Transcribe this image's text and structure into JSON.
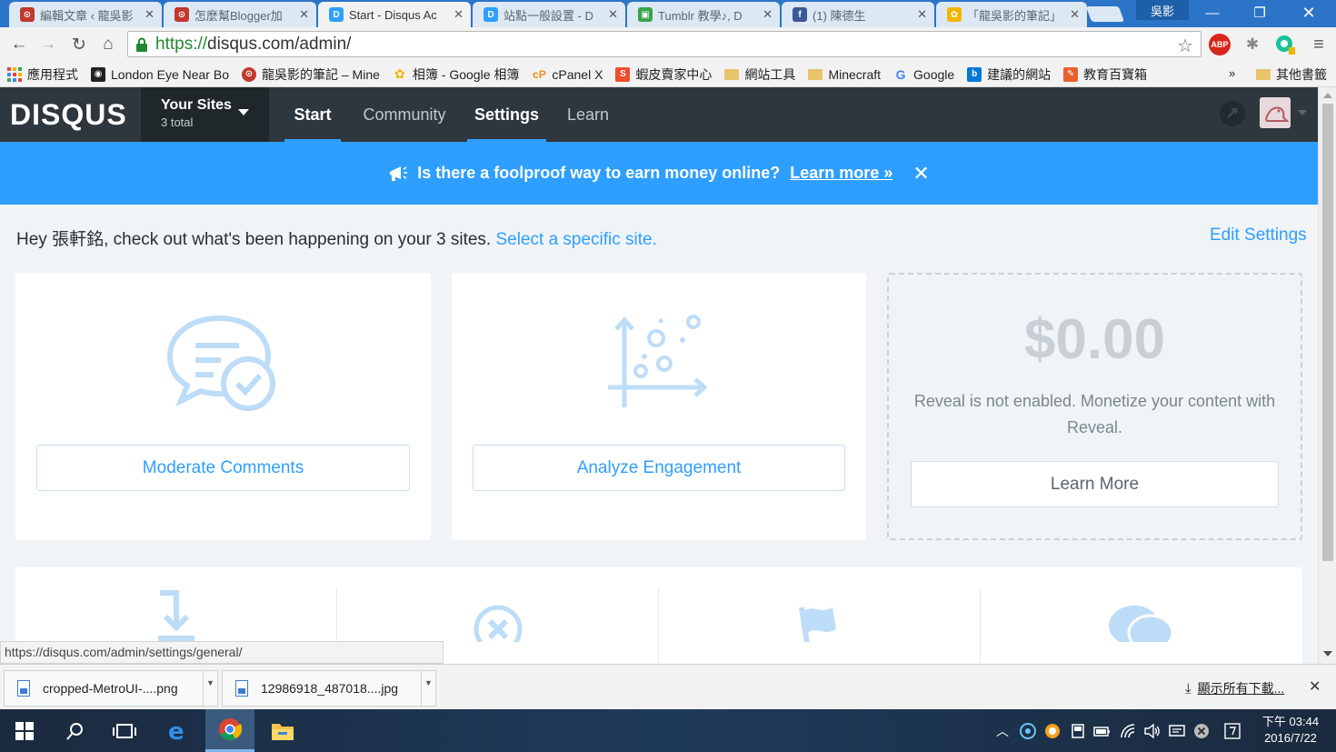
{
  "browser": {
    "tabs": [
      {
        "title": "編輯文章 ‹ 龍吳影",
        "fav_color": "#c0392b",
        "fav_letter": "⊙",
        "active": false
      },
      {
        "title": "怎麼幫Blogger加",
        "fav_color": "#c0392b",
        "fav_letter": "⊙",
        "active": false
      },
      {
        "title": "Start - Disqus Ac",
        "fav_color": "#2e9fff",
        "fav_letter": "D",
        "active": true
      },
      {
        "title": "站點一般設置 - D",
        "fav_color": "#2e9fff",
        "fav_letter": "D",
        "active": false
      },
      {
        "title": "Tumblr 教學♪, D",
        "fav_color": "#3aa34a",
        "fav_letter": "▣",
        "active": false
      },
      {
        "title": "(1) 陳德生",
        "fav_color": "#3b5998",
        "fav_letter": "f",
        "active": false
      },
      {
        "title": "「龍吳影的筆記」",
        "fav_color": "#f4b400",
        "fav_letter": "✿",
        "active": false
      }
    ],
    "user_name": "吳影",
    "url_scheme": "https://",
    "url_rest": "disqus.com/admin/",
    "ext_abp": "ABP",
    "bookmarks": [
      {
        "label": "應用程式",
        "icon": "apps"
      },
      {
        "label": "London Eye Near Bo",
        "icon": "square-dark"
      },
      {
        "label": "龍吳影的筆記 – Mine",
        "icon": "red-circle"
      },
      {
        "label": "相簿 - Google 相簿",
        "icon": "pinwheel"
      },
      {
        "label": "cPanel X",
        "icon": "cp"
      },
      {
        "label": "蝦皮賣家中心",
        "icon": "bag"
      },
      {
        "label": "網站工具",
        "icon": "folder"
      },
      {
        "label": "Minecraft",
        "icon": "folder"
      },
      {
        "label": "Google",
        "icon": "g"
      },
      {
        "label": "建議的網站",
        "icon": "b"
      },
      {
        "label": "教育百寶箱",
        "icon": "edu"
      }
    ],
    "bookmarks_more": "»",
    "bookmarks_other": "其他書籤",
    "status_url": "https://disqus.com/admin/settings/general/"
  },
  "disqus": {
    "logo": "DISQUS",
    "sites_title": "Your Sites",
    "sites_total": "3 total",
    "nav": [
      {
        "label": "Start",
        "state": "active"
      },
      {
        "label": "Community",
        "state": "normal"
      },
      {
        "label": "Settings",
        "state": "bold"
      },
      {
        "label": "Learn",
        "state": "normal"
      }
    ],
    "promo_text": "Is there a foolproof way to earn money online?",
    "promo_link": "Learn more »",
    "greeting_before": "Hey 張軒銘, check out what's been happening on your 3 sites. ",
    "greeting_link": "Select a specific site.",
    "edit_settings": "Edit Settings",
    "cards": {
      "moderate_label": "Moderate Comments",
      "analyze_label": "Analyze Engagement",
      "revenue_amount": "$0.00",
      "revenue_text": "Reveal is not enabled. Monetize your content with Reveal.",
      "learn_more_label": "Learn More"
    }
  },
  "downloads": {
    "items": [
      {
        "name": "cropped-MetroUI-....png"
      },
      {
        "name": "12986918_487018....jpg"
      }
    ],
    "show_all": "顯示所有下載..."
  },
  "taskbar": {
    "time": "下午 03:44",
    "date": "2016/7/22"
  },
  "colors": {
    "disqus_blue": "#2e9fff",
    "header_dark": "#2e373d",
    "icon_blue": "#bddcf7"
  }
}
